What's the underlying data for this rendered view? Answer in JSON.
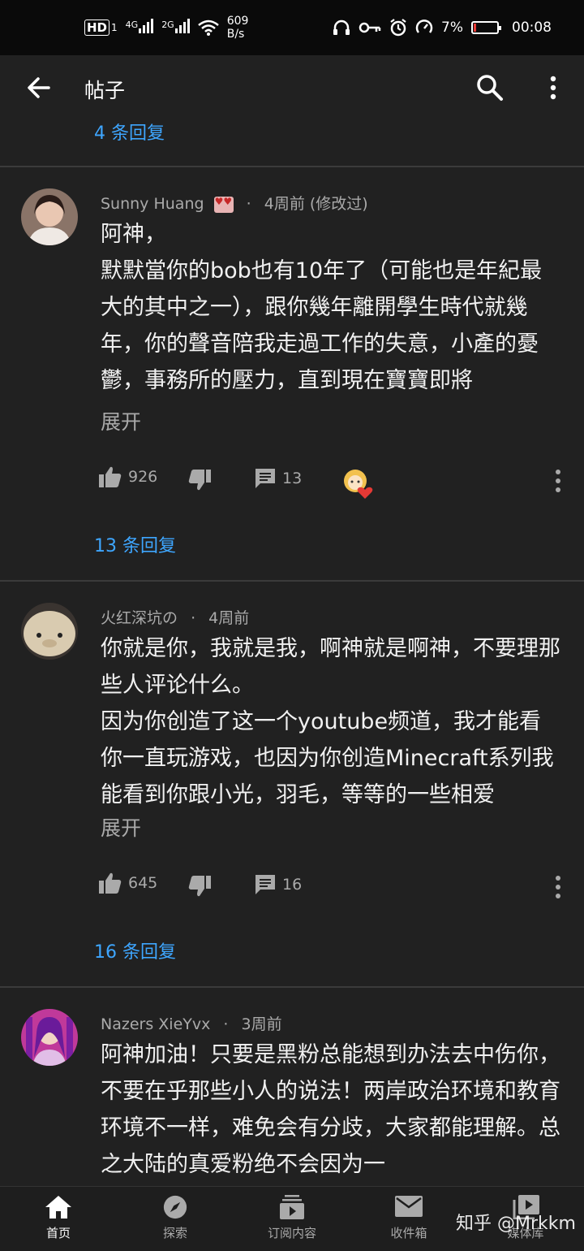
{
  "status_bar": {
    "hd": "HD",
    "sim": "1",
    "net1": "4G",
    "net2": "2G",
    "speed_value": "609",
    "speed_unit": "B/s",
    "battery": "7%",
    "battery_level": 0.07,
    "time": "00:08"
  },
  "app_bar": {
    "title": "帖子"
  },
  "top_partial": {
    "replies": "4 条回复"
  },
  "comments": [
    {
      "author": "Sunny Huang",
      "time": "4周前 (修改过)",
      "lines": [
        "阿神，",
        "默默當你的bob也有10年了（可能也是年紀最大的其中之一），跟你幾年離開學生時代就幾年，你的聲音陪我走過工作的失意，小產的憂鬱，事務所的壓力，直到現在寶寶即將"
      ],
      "expand": "展开",
      "likes": "926",
      "reply_count": "13",
      "replies_link": "13 条回复"
    },
    {
      "author": "火红深坑の",
      "time": "4周前",
      "lines": [
        "你就是你，我就是我，啊神就是啊神，不要理那些人评论什么。",
        "因为你创造了这一个youtube频道，我才能看你一直玩游戏，也因为你创造Minecraft系列我能看到你跟小光，羽毛，等等的一些相爱"
      ],
      "expand": "展开",
      "likes": "645",
      "reply_count": "16",
      "replies_link": "16 条回复"
    },
    {
      "author": "Nazers XieYvx",
      "time": "3周前",
      "lines": [
        "阿神加油！只要是黑粉总能想到办法去中伤你，不要在乎那些小人的说法！两岸政治环境和教育环境不一样，难免会有分歧，大家都能理解。总之大陆的真爱粉绝不会因为一"
      ]
    }
  ],
  "bottom_nav": {
    "items": [
      {
        "label": "首页",
        "icon": "home-icon"
      },
      {
        "label": "探索",
        "icon": "compass-icon"
      },
      {
        "label": "订阅内容",
        "icon": "subscriptions-icon"
      },
      {
        "label": "收件箱",
        "icon": "mail-icon"
      },
      {
        "label": "媒体库",
        "icon": "library-icon"
      }
    ]
  },
  "watermark": "知乎 @Mrkkm",
  "colors": {
    "link": "#3ea6ff",
    "background": "#212121",
    "secondary_text": "#aaaaaa"
  }
}
